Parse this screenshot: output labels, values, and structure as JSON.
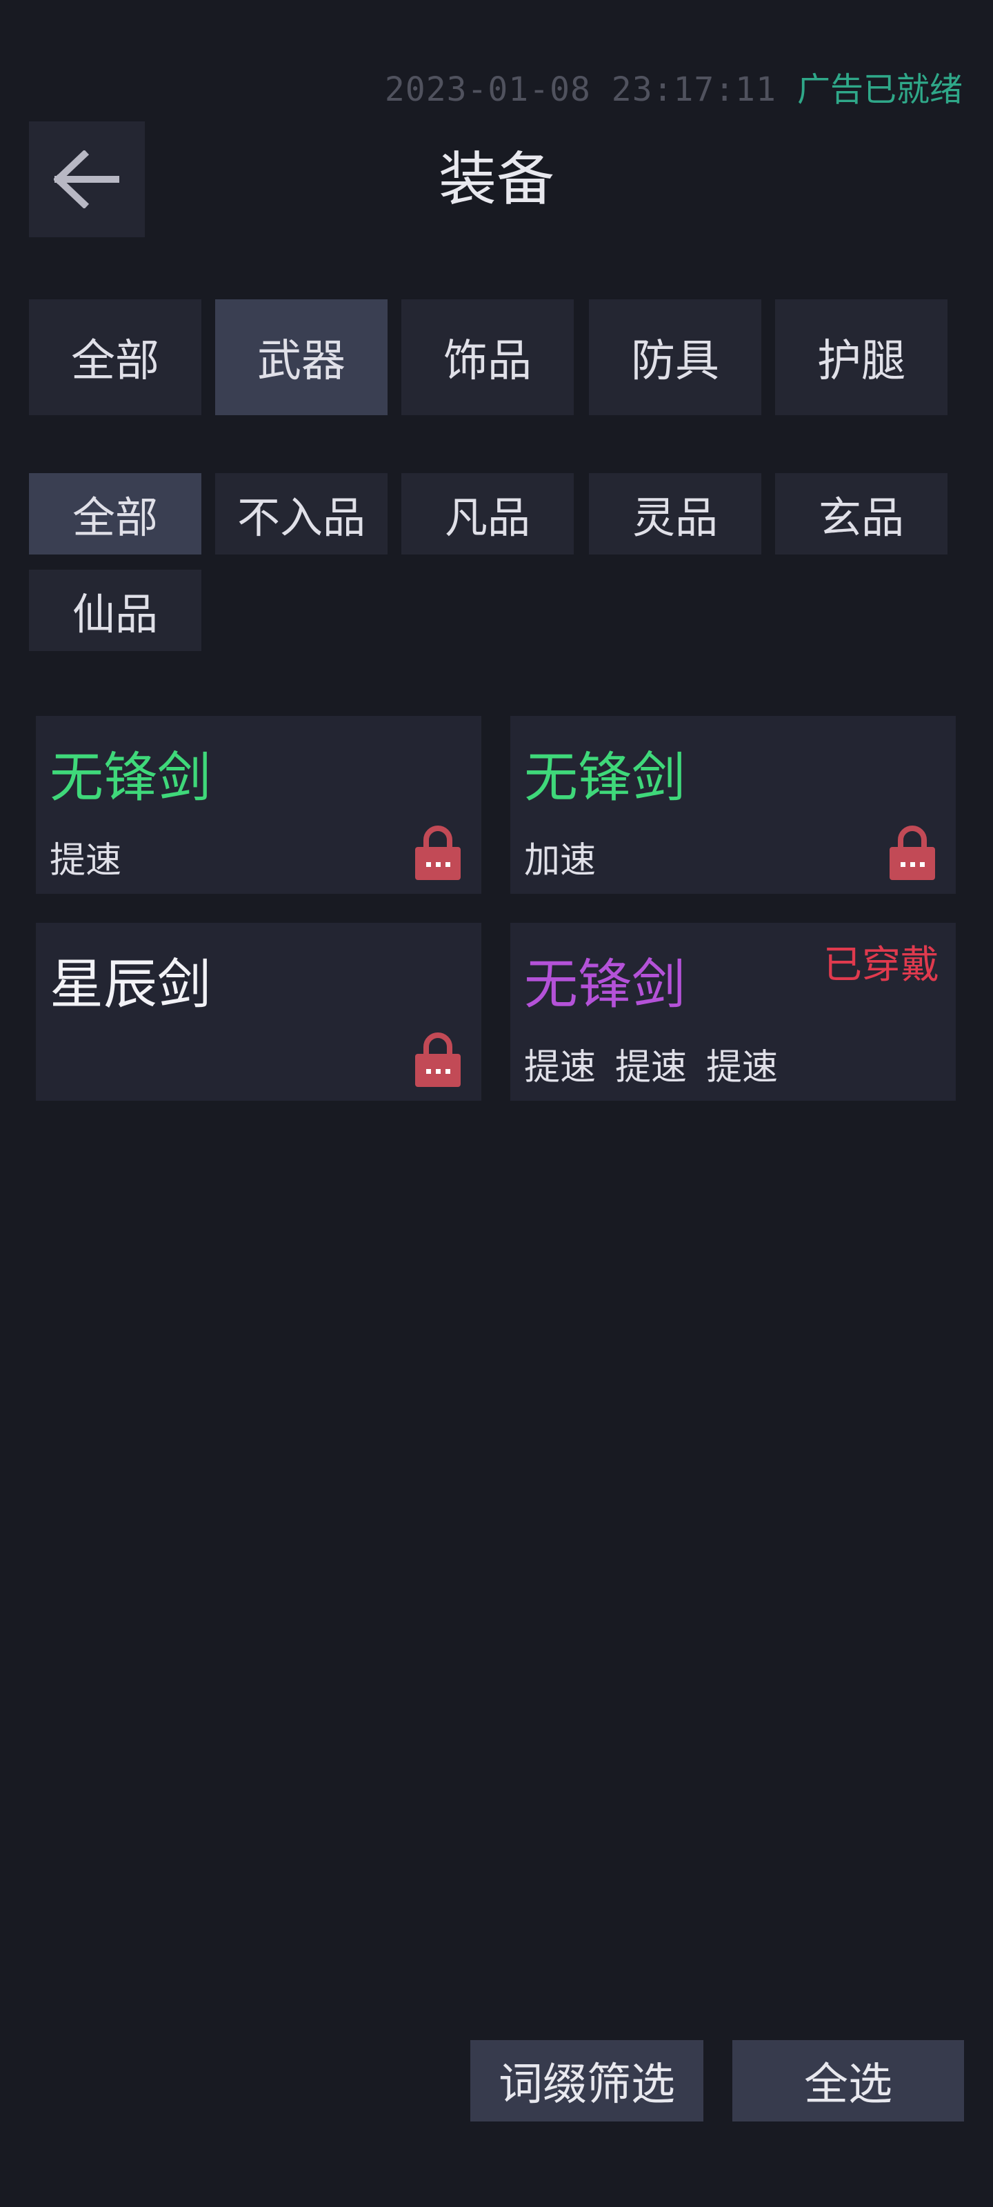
{
  "status": {
    "time": "2023-01-08 23:17:11",
    "ad_status": "广告已就绪"
  },
  "header": {
    "title": "装备"
  },
  "categories": [
    "全部",
    "武器",
    "饰品",
    "防具",
    "护腿"
  ],
  "active_category": 1,
  "grades": [
    "全部",
    "不入品",
    "凡品",
    "灵品",
    "玄品",
    "仙品"
  ],
  "active_grade": 0,
  "items": [
    {
      "name": "无锋剑",
      "name_color": "#3fd87a",
      "affixes": [
        "提速"
      ],
      "locked": true,
      "equipped_label": ""
    },
    {
      "name": "无锋剑",
      "name_color": "#3fd87a",
      "affixes": [
        "加速"
      ],
      "locked": true,
      "equipped_label": ""
    },
    {
      "name": "星辰剑",
      "name_color": "#f2f2f6",
      "affixes": [],
      "locked": true,
      "equipped_label": ""
    },
    {
      "name": "无锋剑",
      "name_color": "#b452d8",
      "affixes": [
        "提速",
        "提速",
        "提速"
      ],
      "locked": false,
      "equipped_label": "已穿戴"
    }
  ],
  "colors": {
    "lock": "#c24a56",
    "equipped": "#e03a4e"
  },
  "buttons": {
    "affix_filter": "词缀筛选",
    "select_all": "全选"
  }
}
